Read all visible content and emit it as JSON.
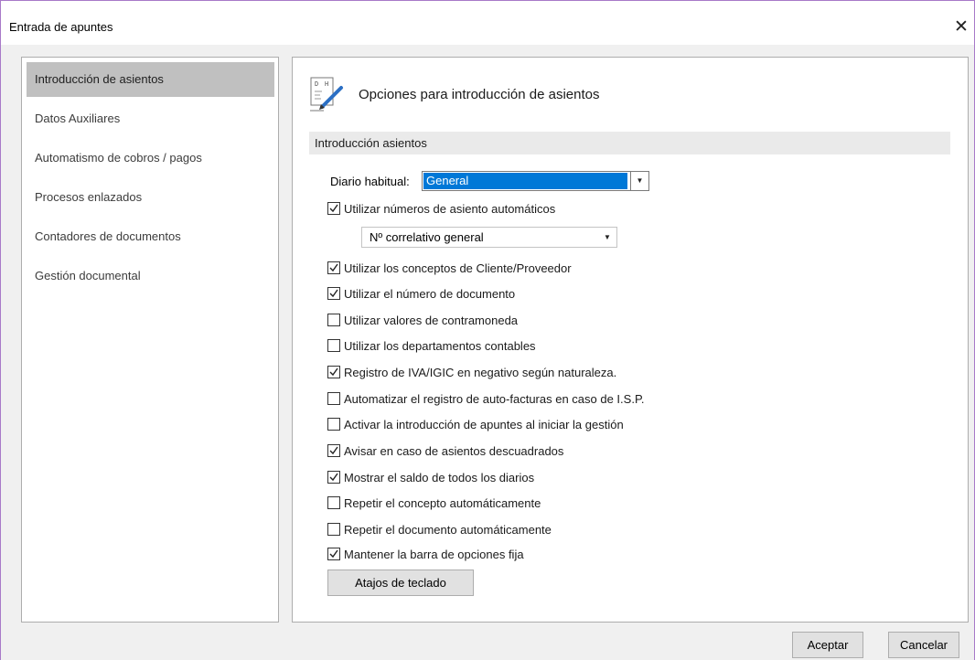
{
  "window": {
    "title": "Entrada de apuntes",
    "close_glyph": "✕"
  },
  "sidebar": {
    "items": [
      {
        "label": "Introducción de asientos",
        "active": true
      },
      {
        "label": "Datos Auxiliares",
        "active": false
      },
      {
        "label": "Automatismo de cobros / pagos",
        "active": false
      },
      {
        "label": "Procesos enlazados",
        "active": false
      },
      {
        "label": "Contadores de documentos",
        "active": false
      },
      {
        "label": "Gestión documental",
        "active": false
      }
    ]
  },
  "main": {
    "icon": "document-edit-icon",
    "heading": "Opciones para introducción de asientos",
    "section_title": "Introducción asientos",
    "diario": {
      "label": "Diario habitual:",
      "value": "General"
    },
    "numero_combo": {
      "value": "Nº correlativo general"
    },
    "options": [
      {
        "label": "Utilizar números de asiento automáticos",
        "checked": true
      },
      {
        "label": "Utilizar los conceptos de Cliente/Proveedor",
        "checked": true
      },
      {
        "label": "Utilizar el número de documento",
        "checked": true
      },
      {
        "label": "Utilizar valores de contramoneda",
        "checked": false
      },
      {
        "label": "Utilizar los departamentos contables",
        "checked": false
      },
      {
        "label": "Registro de IVA/IGIC en negativo según naturaleza.",
        "checked": true
      },
      {
        "label": "Automatizar el registro de auto-facturas en caso de I.S.P.",
        "checked": false
      },
      {
        "label": "Activar la introducción de apuntes al iniciar la gestión",
        "checked": false
      },
      {
        "label": "Avisar en caso de asientos descuadrados",
        "checked": true
      },
      {
        "label": "Mostrar el saldo de todos los diarios",
        "checked": true
      },
      {
        "label": "Repetir el concepto automáticamente",
        "checked": false
      },
      {
        "label": "Repetir el documento automáticamente",
        "checked": false
      },
      {
        "label": "Mantener la barra de opciones fija",
        "checked": true
      }
    ],
    "shortcuts_button": "Atajos de teclado"
  },
  "footer": {
    "ok_label": "Aceptar",
    "cancel_label": "Cancelar"
  },
  "colors": {
    "selection": "#0078d7",
    "active_item": "#c0c0c0",
    "window_border": "#a87ac8"
  }
}
